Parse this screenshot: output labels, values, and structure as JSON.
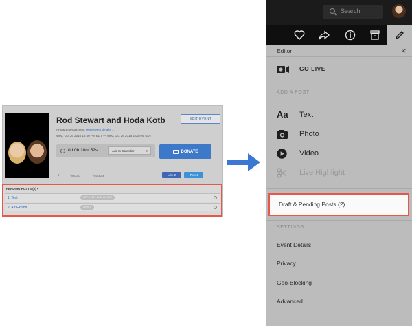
{
  "event": {
    "title": "Rod Stewart and Hoda Kotb",
    "category": "Arts & Entertainment",
    "more_details": "More event details ...",
    "dates": "Wed, Oct 26 2016 12:00 PM EDT  —  Wed, Oct 26 2016 1:00 PM EDT",
    "edit_button": "EDIT EVENT",
    "countdown": "0d 0h 10m 52s",
    "calendar_select": "Add to Calendar",
    "donate_button": "DONATE",
    "share_label": "Share",
    "embed_label": "Embed",
    "like_button": "Like 2",
    "tweet_button": "Tweet",
    "pending_header": "PENDING POSTS (2)",
    "pending_posts": [
      {
        "name": "1. Text",
        "badge": "SEP 8 2017 11:30 AM EDT"
      },
      {
        "name": "2. Art Exhibit",
        "badge": "DRAFT"
      }
    ]
  },
  "panel": {
    "search_placeholder": "Search",
    "editor_label": "Editor",
    "go_live": "GO LIVE",
    "add_post_section": "ADD A POST",
    "post_types": [
      {
        "label": "Text",
        "icon": "text-aa-icon"
      },
      {
        "label": "Photo",
        "icon": "camera-icon"
      },
      {
        "label": "Video",
        "icon": "play-icon"
      },
      {
        "label": "Live Highlight",
        "icon": "scissors-icon"
      }
    ],
    "drafts_item": "Draft & Pending Posts (2)",
    "settings_section": "SETTINGS",
    "settings_items": [
      "Event Details",
      "Privacy",
      "Geo-Blocking",
      "Advanced"
    ]
  },
  "colors": {
    "highlight": "#e8574a",
    "arrow": "#3a78d4",
    "topbar": "#1b1b1b",
    "panel_bg": "#bcbcbc"
  }
}
